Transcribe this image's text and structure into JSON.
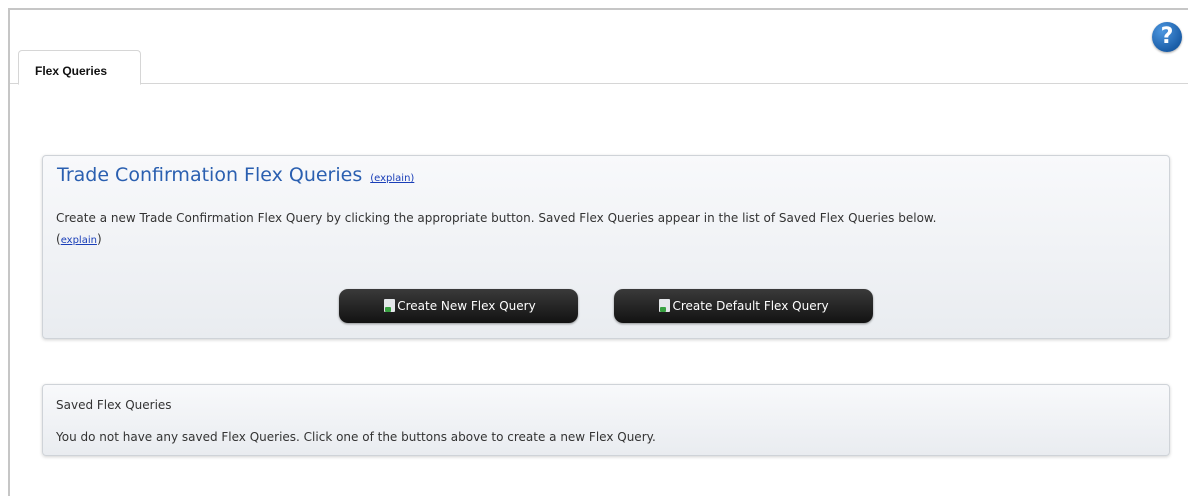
{
  "help": {
    "symbol": "?"
  },
  "tabs": [
    {
      "label": "Flex Queries"
    }
  ],
  "trade": {
    "title": "Trade Confirmation Flex Queries",
    "title_explain": "(explain)",
    "description": "Create a new Trade Confirmation Flex Query by clicking the appropriate button. Saved Flex Queries appear in the list of Saved Flex Queries below.",
    "desc_explain": "explain",
    "buttons": {
      "create_new": "Create New Flex Query",
      "create_default": "Create Default Flex Query"
    }
  },
  "saved": {
    "title": "Saved Flex Queries",
    "empty_message": "You do not have any saved Flex Queries. Click one of the buttons above to create a new Flex Query."
  },
  "colors": {
    "title_blue": "#2a5fb0",
    "link_blue": "#1a3fb8",
    "button_dark": "#121212",
    "help_blue": "#1b5ea8"
  },
  "icons": [
    "help-icon",
    "document-icon"
  ]
}
